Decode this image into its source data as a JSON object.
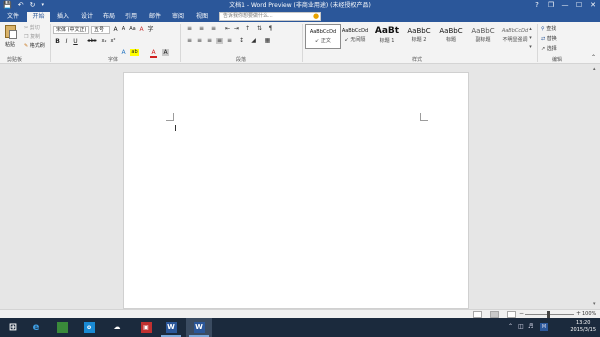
{
  "titlebar": {
    "title": "文档1 - Word Preview (非商业用途) (未经授权产品)",
    "icons": [
      "save-icon",
      "undo-icon",
      "redo-icon"
    ]
  },
  "window_controls": {
    "help": "?",
    "restore": "❐",
    "minimize": "—",
    "maximize": "☐",
    "close": "✕"
  },
  "tabs": [
    {
      "label": "文件"
    },
    {
      "label": "开始",
      "active": true
    },
    {
      "label": "插入"
    },
    {
      "label": "设计"
    },
    {
      "label": "布局"
    },
    {
      "label": "引用"
    },
    {
      "label": "邮件"
    },
    {
      "label": "审阅"
    },
    {
      "label": "视图"
    }
  ],
  "tellme": {
    "placeholder": "告诉我你想要做什么..."
  },
  "clipboard": {
    "label": "剪贴板",
    "paste": "粘贴",
    "cut": "剪切",
    "copy": "复制",
    "format_painter": "格式刷"
  },
  "font": {
    "label": "字体",
    "font_name": "宋体 (中文正)",
    "font_size": "五号",
    "grow": "A",
    "shrink": "A",
    "case": "Aa",
    "clear": "A",
    "bold": "B",
    "italic": "I",
    "underline": "U",
    "strike": "abc",
    "subscript": "x₂",
    "superscript": "x²",
    "effects": "A",
    "highlight": "ab",
    "font_color": "A",
    "char_shading": "A",
    "enclose": "字"
  },
  "paragraph": {
    "label": "段落"
  },
  "styles": {
    "label": "样式",
    "items": [
      {
        "preview": "AaBbCcDd",
        "name": "↙ 正文",
        "selected": true
      },
      {
        "preview": "AaBbCcDd",
        "name": "↙ 无间隔"
      },
      {
        "preview": "AaBt",
        "name": "标题 1"
      },
      {
        "preview": "AaBbC",
        "name": "标题 2"
      },
      {
        "preview": "AaBbC",
        "name": "标题"
      },
      {
        "preview": "AaBbC",
        "name": "副标题"
      },
      {
        "preview": "AaBbCcDd",
        "name": "不明显强调"
      }
    ]
  },
  "editing": {
    "label": "编辑",
    "find": "查找",
    "replace": "替换",
    "select": "选择"
  },
  "statusbar": {
    "zoom": "100%",
    "zoom_minus": "−",
    "zoom_plus": "+"
  },
  "taskbar": {
    "apps": [
      {
        "icon": "windows-start-icon"
      },
      {
        "icon": "internet-explorer-icon"
      },
      {
        "icon": "store-icon"
      },
      {
        "icon": "outlook-icon"
      },
      {
        "icon": "onedrive-icon"
      },
      {
        "icon": "app-icon"
      },
      {
        "icon": "word-icon"
      },
      {
        "icon": "word-icon"
      }
    ],
    "time": "13:20",
    "date": "2015/3/15"
  },
  "colors": {
    "word_blue": "#2b579a",
    "ribbon_bg": "#f3f3f3",
    "doc_bg": "#e6e6e6",
    "taskbar": "#1b2a3d"
  }
}
